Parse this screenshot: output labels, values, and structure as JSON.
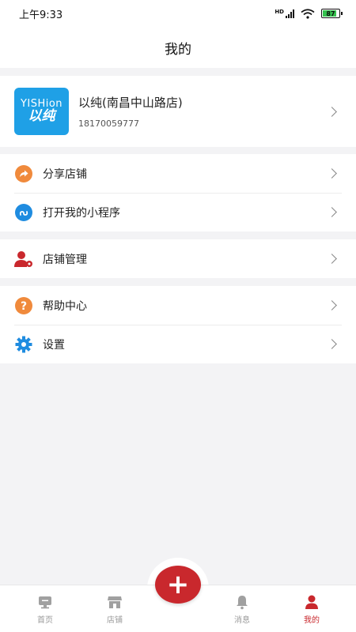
{
  "status_bar": {
    "time": "上午9:33",
    "network_label": "HD",
    "battery": "87",
    "battery_level": 0.87
  },
  "header": {
    "title": "我的"
  },
  "profile": {
    "logo_text_en": "YISHion",
    "logo_text_cn": "以纯",
    "store_name": "以纯(南昌中山路店)",
    "phone": "18170059777"
  },
  "menu_groups": [
    {
      "items": [
        {
          "label": "分享店铺",
          "icon": "share-arrow-icon",
          "color": "#f08a3c"
        },
        {
          "label": "打开我的小程序",
          "icon": "mini-program-icon",
          "color": "#1f8ce0"
        }
      ]
    },
    {
      "items": [
        {
          "label": "店铺管理",
          "icon": "user-settings-icon",
          "color": "#c9282d"
        }
      ]
    },
    {
      "items": [
        {
          "label": "帮助中心",
          "icon": "question-icon",
          "color": "#f08a3c"
        },
        {
          "label": "设置",
          "icon": "gear-icon",
          "color": "#1f8ce0"
        }
      ]
    }
  ],
  "tab_bar": {
    "tabs": [
      {
        "label": "首页",
        "icon": "home-icon"
      },
      {
        "label": "店铺",
        "icon": "store-icon"
      },
      {
        "label": "消息",
        "icon": "bell-icon"
      },
      {
        "label": "我的",
        "icon": "person-icon"
      }
    ],
    "active": "我的",
    "center_action": "+",
    "accent": "#c9282d"
  }
}
